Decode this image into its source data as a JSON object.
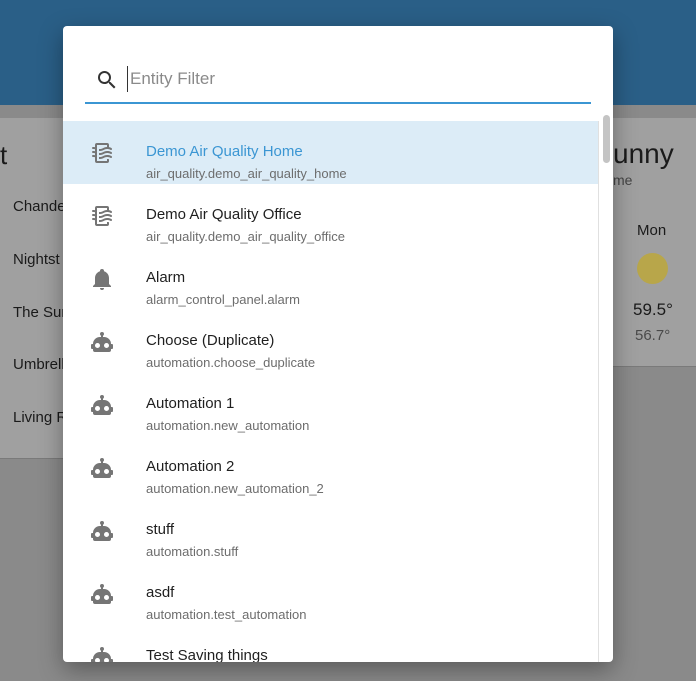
{
  "background": {
    "left_title": "t",
    "left_items": [
      "Chande",
      "Nightst",
      "The Sun",
      "Umbrell",
      "Living R"
    ],
    "right_title": "unny",
    "right_subtitle": "me",
    "forecast_day": "Mon",
    "forecast_high": "59.5°",
    "forecast_low": "56.7°"
  },
  "dialog": {
    "search": {
      "placeholder": "Entity Filter",
      "value": ""
    },
    "items": [
      {
        "name": "Demo Air Quality Home",
        "entity_id": "air_quality.demo_air_quality_home",
        "icon": "air-filter-icon",
        "selected": true
      },
      {
        "name": "Demo Air Quality Office",
        "entity_id": "air_quality.demo_air_quality_office",
        "icon": "air-filter-icon"
      },
      {
        "name": "Alarm",
        "entity_id": "alarm_control_panel.alarm",
        "icon": "bell-icon"
      },
      {
        "name": "Choose (Duplicate)",
        "entity_id": "automation.choose_duplicate",
        "icon": "robot-icon"
      },
      {
        "name": "Automation 1",
        "entity_id": "automation.new_automation",
        "icon": "robot-icon"
      },
      {
        "name": "Automation 2",
        "entity_id": "automation.new_automation_2",
        "icon": "robot-icon"
      },
      {
        "name": "stuff",
        "entity_id": "automation.stuff",
        "icon": "robot-icon"
      },
      {
        "name": "asdf",
        "entity_id": "automation.test_automation",
        "icon": "robot-icon"
      },
      {
        "name": "Test Saving things",
        "entity_id": "",
        "icon": "robot-icon"
      }
    ],
    "accent_color": "#3b96d3",
    "selected_bg": "#dcecf7"
  }
}
